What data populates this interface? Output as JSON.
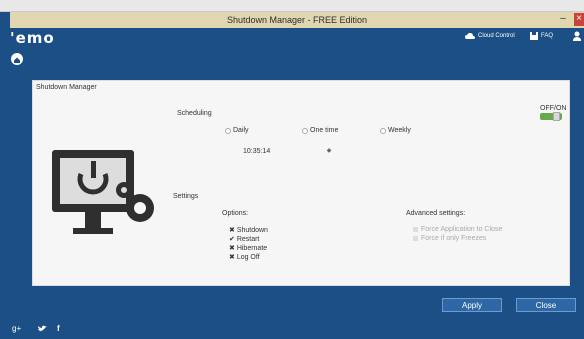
{
  "window": {
    "title": "Shutdown Manager - FREE Edition",
    "minimize_label": "–",
    "close_label": "×"
  },
  "header": {
    "logo": "'emo",
    "cloud_control": "Cloud Control",
    "faq": "FAQ"
  },
  "panel": {
    "title": "Shutdown Manager",
    "off_on_label": "OFF/ON",
    "scheduling": {
      "label": "Scheduling",
      "options": [
        "Daily",
        "One time",
        "Weekly"
      ],
      "time": "10:35:14"
    },
    "settings": {
      "label": "Settings",
      "options_label": "Options:",
      "options": [
        "Shutdown",
        "Restart",
        "Hibernate",
        "Log Off"
      ],
      "advanced_label": "Advanced settings:",
      "advanced": [
        "Force Application to Close",
        "Force if only Freezes"
      ]
    }
  },
  "footer": {
    "apply_label": "Apply",
    "close_label": "Close"
  },
  "colors": {
    "brand": "#1c4f86",
    "toggle_on": "#6aa84f"
  }
}
